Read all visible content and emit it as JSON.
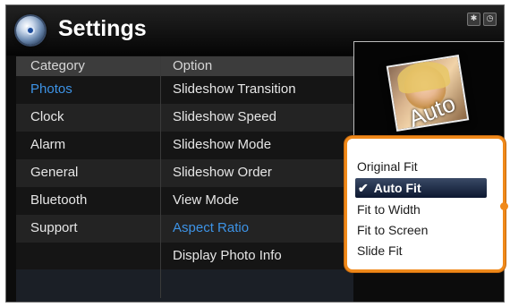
{
  "header": {
    "title": "Settings",
    "status_icons": [
      "bluetooth-icon",
      "clock-icon"
    ],
    "bluetooth_glyph": "✱",
    "clock_glyph": "◷"
  },
  "table": {
    "category_header": "Category",
    "option_header": "Option",
    "categories": [
      "Photos",
      "Clock",
      "Alarm",
      "General",
      "Bluetooth",
      "Support"
    ],
    "options": [
      "Slideshow Transition",
      "Slideshow Speed",
      "Slideshow Mode",
      "Slideshow Order",
      "View Mode",
      "Aspect Ratio",
      "Display Photo Info"
    ],
    "selected_category": "Photos",
    "selected_option": "Aspect Ratio"
  },
  "preview": {
    "caption": "Auto"
  },
  "popup": {
    "items": [
      "Original Fit",
      "Auto Fit",
      "Fit to Width",
      "Fit to Screen",
      "Slide Fit"
    ],
    "selected": "Auto Fit",
    "check_glyph": "✔"
  },
  "colors": {
    "accent": "#3d93e6",
    "highlight_border": "#f0891a",
    "selection": "#0c1730"
  }
}
